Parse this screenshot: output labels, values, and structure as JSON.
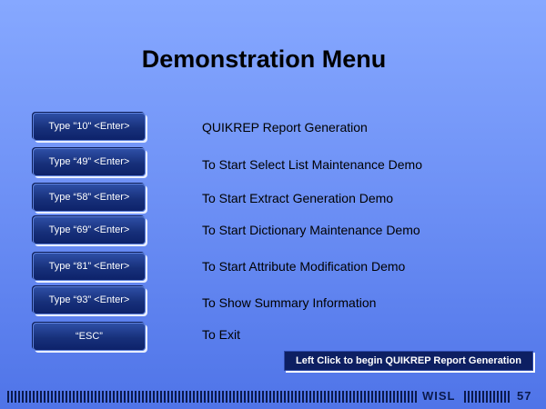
{
  "page": {
    "title": "Demonstration Menu"
  },
  "menu": [
    {
      "button": "Type \"10\" <Enter>",
      "description": "QUIKREP Report Generation"
    },
    {
      "button": "Type “49” <Enter>",
      "description": "To Start Select List Maintenance Demo"
    },
    {
      "button": "Type “58” <Enter>",
      "description": "To Start Extract Generation Demo"
    },
    {
      "button": "Type “69” <Enter>",
      "description": "To Start Dictionary Maintenance Demo"
    },
    {
      "button": "Type “81” <Enter>",
      "description": "To Start Attribute Modification Demo"
    },
    {
      "button": "Type “93” <Enter>",
      "description": "To Show Summary Information"
    },
    {
      "button": "“ESC”",
      "description": "To Exit"
    }
  ],
  "hint": {
    "text": "Left Click to begin QUIKREP Report Generation"
  },
  "footer": {
    "org": "WISL",
    "page_number": "57"
  },
  "colors": {
    "background_top": "#86a8ff",
    "background_bottom": "#4f74e8",
    "button_fill": "#17307a",
    "hint_fill": "#0d1f62",
    "footer_ink": "#0b1a4d"
  }
}
